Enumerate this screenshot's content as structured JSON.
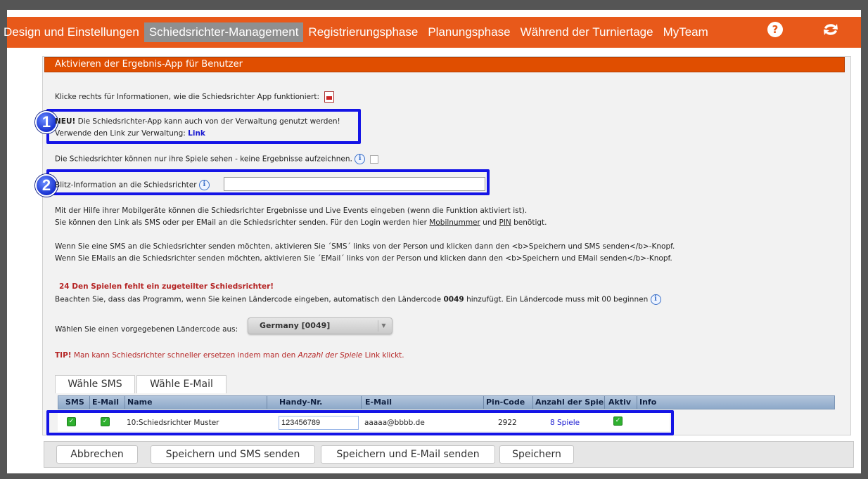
{
  "nav": {
    "items": [
      {
        "label": "Design und Einstellungen"
      },
      {
        "label": "Schiedsrichter-Management"
      },
      {
        "label": "Registrierungsphase"
      },
      {
        "label": "Planungsphase"
      },
      {
        "label": "Während der Turniertage"
      },
      {
        "label": "MyTeam"
      }
    ],
    "active_index": 1,
    "help_icon": "question-icon",
    "refresh_icon": "refresh-icon"
  },
  "panel": {
    "title": "Aktivieren der Ergebnis-App für Benutzer",
    "info_line": "Klicke rechts für Informationen, wie die Schiedsrichter App funktioniert:",
    "new_label": "NEU!",
    "new_text": "Die Schiedsrichter-App kann auch von der Verwaltung genutzt werden!",
    "admin_link_text": "Verwende den Link zur Verwaltung:",
    "admin_link_label": "Link",
    "only_games_text": "Die Schiedsrichter können nur ihre Spiele sehen - keine Ergebnisse aufzeichnen.",
    "blitz_label": "Blitz-Information an die Schiedsrichter",
    "blitz_value": "",
    "help_line1": "Mit der Hilfe ihrer Mobilgeräte können die Schiedsrichter Ergebnisse und Live Events eingeben (wenn die Funktion aktiviert ist).",
    "help_line2_a": "Sie können den Link als SMS oder per EMail an die Schiedsrichter senden. Für den Login werden hier",
    "help_line2_mobile": "Mobilnummer",
    "help_line2_und": "und",
    "help_line2_pin": "PIN",
    "help_line2_b": "benötigt.",
    "sms_line": "Wenn Sie eine SMS an die Schiedsrichter senden möchten, aktivieren Sie ´SMS´ links von der Person und klicken dann den <b>Speichern und SMS senden</b>-Knopf.",
    "email_line": "Wenn Sie EMails an die Schiedsrichter senden möchten, aktivieren Sie ´EMail´ links von der Person und klicken dann den <b>Speichern und EMail senden</b>-Knopf.",
    "warning": "24 Den Spielen fehlt ein zugeteilter Schiedsrichter!",
    "country_note_a": "Beachten Sie, dass das Programm, wenn Sie keinen Ländercode eingeben, automatisch den Ländercode",
    "country_note_code": "0049",
    "country_note_b": "hinzufügt. Ein Ländercode muss mit 00 beginnen",
    "country_select_label": "Wählen Sie einen vorgegebenen Ländercode aus:",
    "country_select_value": "Germany [0049]",
    "tip_label": "TIP!",
    "tip_text_a": "Man kann Schiedsrichter schneller ersetzen indem man den",
    "tip_text_em": "Anzahl der Spiele",
    "tip_text_b": "Link klickt."
  },
  "tabs": [
    {
      "label": "Wähle SMS"
    },
    {
      "label": "Wähle E-Mail"
    }
  ],
  "table": {
    "columns": [
      "SMS",
      "E-Mail",
      "Name",
      "Handy-Nr.",
      "E-Mail",
      "Pin-Code",
      "Anzahl der Spie",
      "Aktiv",
      "Info"
    ],
    "rows": [
      {
        "sms": true,
        "email_checked": true,
        "name": "10:Schiedsrichter Muster",
        "phone": "123456789",
        "email": "aaaaa@bbbb.de",
        "pin": "2922",
        "games": "8 Spiele",
        "active": true
      }
    ]
  },
  "buttons": {
    "cancel": "Abbrechen",
    "save_sms": "Speichern und SMS senden",
    "save_email": "Speichern und E-Mail senden",
    "save": "Speichern"
  },
  "badges": [
    "1",
    "2"
  ],
  "colors": {
    "nav_bg": "#e8591a",
    "nav_active": "#8f8f8f",
    "panel_header": "#e04e00",
    "highlight": "#1414e6",
    "warning": "#b52525"
  }
}
